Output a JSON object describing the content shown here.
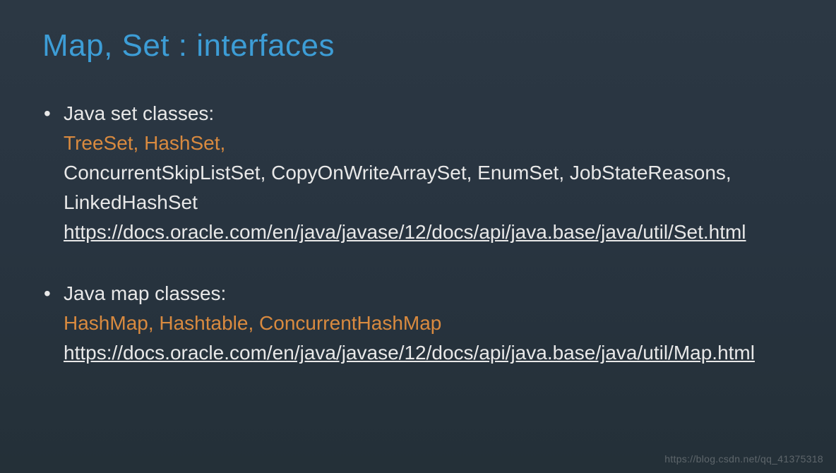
{
  "title": "Map, Set : interfaces",
  "items": [
    {
      "label": "Java set classes:",
      "highlight": "TreeSet, HashSet,",
      "body": "ConcurrentSkipListSet, CopyOnWriteArraySet, EnumSet, JobStateReasons, LinkedHashSet",
      "link": "https://docs.oracle.com/en/java/javase/12/docs/api/java.base/java/util/Set.html"
    },
    {
      "label": "Java map classes:",
      "highlight": "HashMap, Hashtable, ConcurrentHashMap",
      "body": "",
      "link": "https://docs.oracle.com/en/java/javase/12/docs/api/java.base/java/util/Map.html"
    }
  ],
  "watermark": "https://blog.csdn.net/qq_41375318"
}
